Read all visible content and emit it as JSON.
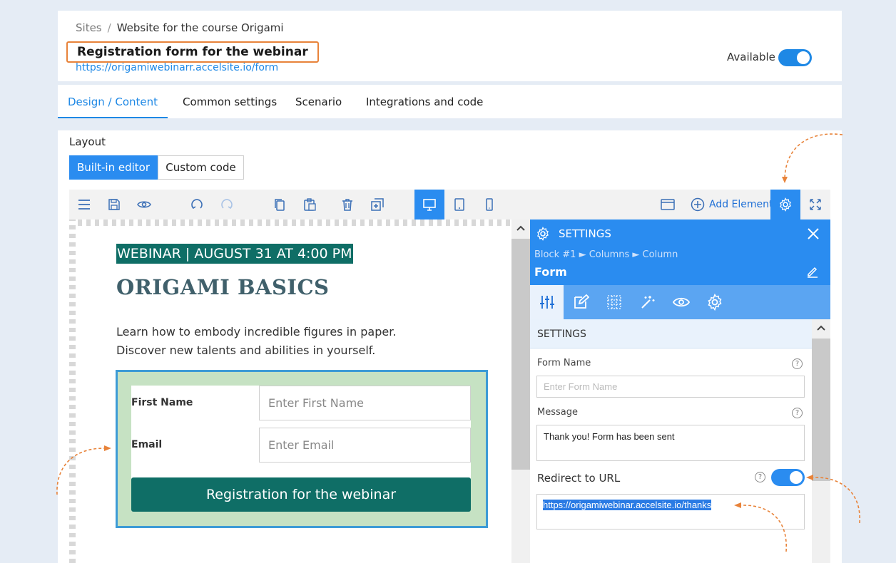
{
  "header": {
    "breadcrumb_root": "Sites",
    "breadcrumb_separator": "/",
    "breadcrumb_current": "Website for the course Origami",
    "title": "Registration form for the webinar",
    "url": "https://origamiwebinarr.accelsite.io/form",
    "available_label": "Available",
    "available_on": true
  },
  "tabs": [
    {
      "label": "Design / Content",
      "active": true
    },
    {
      "label": "Common settings",
      "active": false
    },
    {
      "label": "Scenario",
      "active": false
    },
    {
      "label": "Integrations and code",
      "active": false
    }
  ],
  "layout": {
    "label": "Layout",
    "builtin_label": "Built-in editor",
    "custom_label": "Custom code",
    "selected": "Built-in editor"
  },
  "toolbar": {
    "icons": [
      "menu-icon",
      "save-icon",
      "preview-icon",
      "undo-icon",
      "redo-icon",
      "copy-icon",
      "paste-icon",
      "delete-icon",
      "duplicate-icon",
      "desktop-icon",
      "tablet-icon",
      "mobile-icon",
      "browser-window-icon",
      "gear-icon",
      "fullscreen-icon"
    ],
    "active_device": "desktop",
    "add_element_label": "Add Element"
  },
  "canvas": {
    "tag": "WEBINAR | AUGUST 31 AT 4:00 PM",
    "title": "ORIGAMI BASICS",
    "desc_line1": "Learn how to embody incredible figures in paper.",
    "desc_line2": "Discover new talents and abilities in yourself.",
    "form": {
      "first_name_label": "First Name",
      "first_name_placeholder": "Enter First Name",
      "email_label": "Email",
      "email_placeholder": "Enter Email",
      "submit_label": "Registration for the webinar"
    }
  },
  "settings_panel": {
    "title": "SETTINGS",
    "path": "Block #1 ► Columns ► Column",
    "element_title": "Form",
    "tabs": [
      "sliders-icon",
      "edit-icon",
      "grid-icon",
      "magic-wand-icon",
      "eye-icon",
      "gear-icon"
    ],
    "section_title": "SETTINGS",
    "form_name_label": "Form Name",
    "form_name_placeholder": "Enter Form Name",
    "message_label": "Message",
    "message_value": "Thank you! Form has been sent",
    "redirect_label": "Redirect to URL",
    "redirect_on": true,
    "redirect_url": "https://origamiwebinar.accelsite.io/thanks",
    "help_glyph": "?"
  },
  "colors": {
    "accent": "#2a8cf0",
    "title_highlight_border": "#e8833a",
    "form_button": "#0f6e66",
    "form_background": "#c6e2c3",
    "annotation_arrow": "#e8833a"
  }
}
